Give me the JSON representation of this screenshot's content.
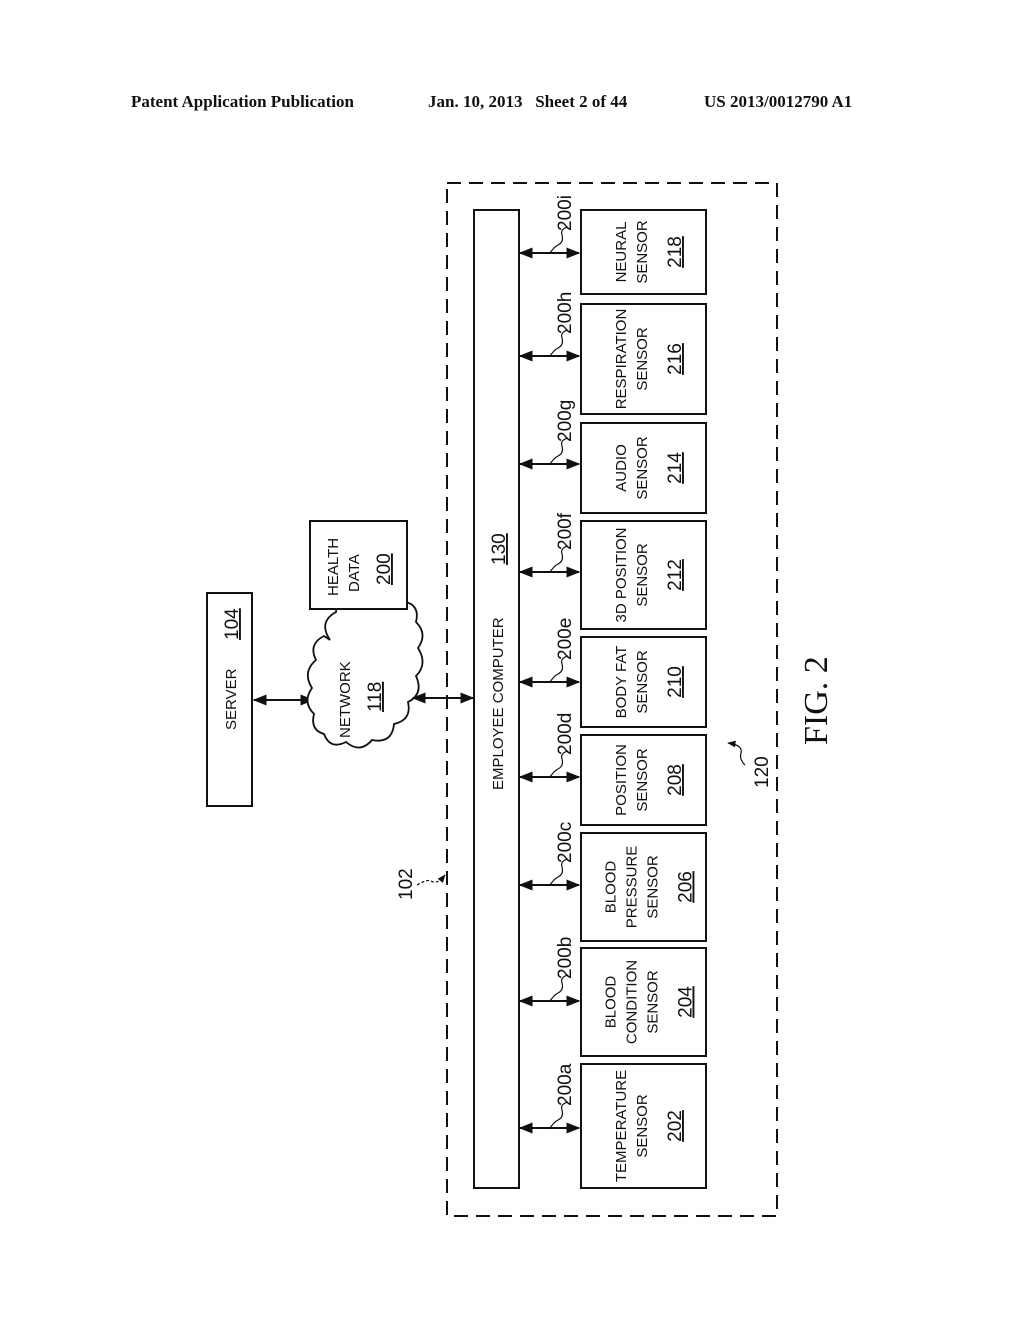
{
  "header": {
    "publication": "Patent Application Publication",
    "date_sheet": "Jan. 10, 2013   Sheet 2 of 44",
    "number": "US 2013/0012790 A1"
  },
  "figure_label": "FIG. 2",
  "server": {
    "label": "SERVER",
    "ref": "104"
  },
  "network": {
    "label": "NETWORK",
    "ref": "118"
  },
  "health_data": {
    "line1": "HEALTH",
    "line2": "DATA",
    "ref": "200"
  },
  "employee_computer": {
    "label": "EMPLOYEE COMPUTER",
    "ref": "130"
  },
  "system_ref": "102",
  "sensor_group_ref": "120",
  "sensors": [
    {
      "lines": [
        "TEMPERATURE",
        "SENSOR"
      ],
      "ref": "202",
      "link": "200a"
    },
    {
      "lines": [
        "BLOOD",
        "CONDITION",
        "SENSOR"
      ],
      "ref": "204",
      "link": "200b"
    },
    {
      "lines": [
        "BLOOD",
        "PRESSURE",
        "SENSOR"
      ],
      "ref": "206",
      "link": "200c"
    },
    {
      "lines": [
        "POSITION",
        "SENSOR"
      ],
      "ref": "208",
      "link": "200d"
    },
    {
      "lines": [
        "BODY FAT",
        "SENSOR"
      ],
      "ref": "210",
      "link": "200e"
    },
    {
      "lines": [
        "3D POSITION",
        "SENSOR"
      ],
      "ref": "212",
      "link": "200f"
    },
    {
      "lines": [
        "AUDIO",
        "SENSOR"
      ],
      "ref": "214",
      "link": "200g"
    },
    {
      "lines": [
        "RESPIRATION",
        "SENSOR"
      ],
      "ref": "216",
      "link": "200h"
    },
    {
      "lines": [
        "NEURAL",
        "SENSOR"
      ],
      "ref": "218",
      "link": "200i"
    }
  ]
}
